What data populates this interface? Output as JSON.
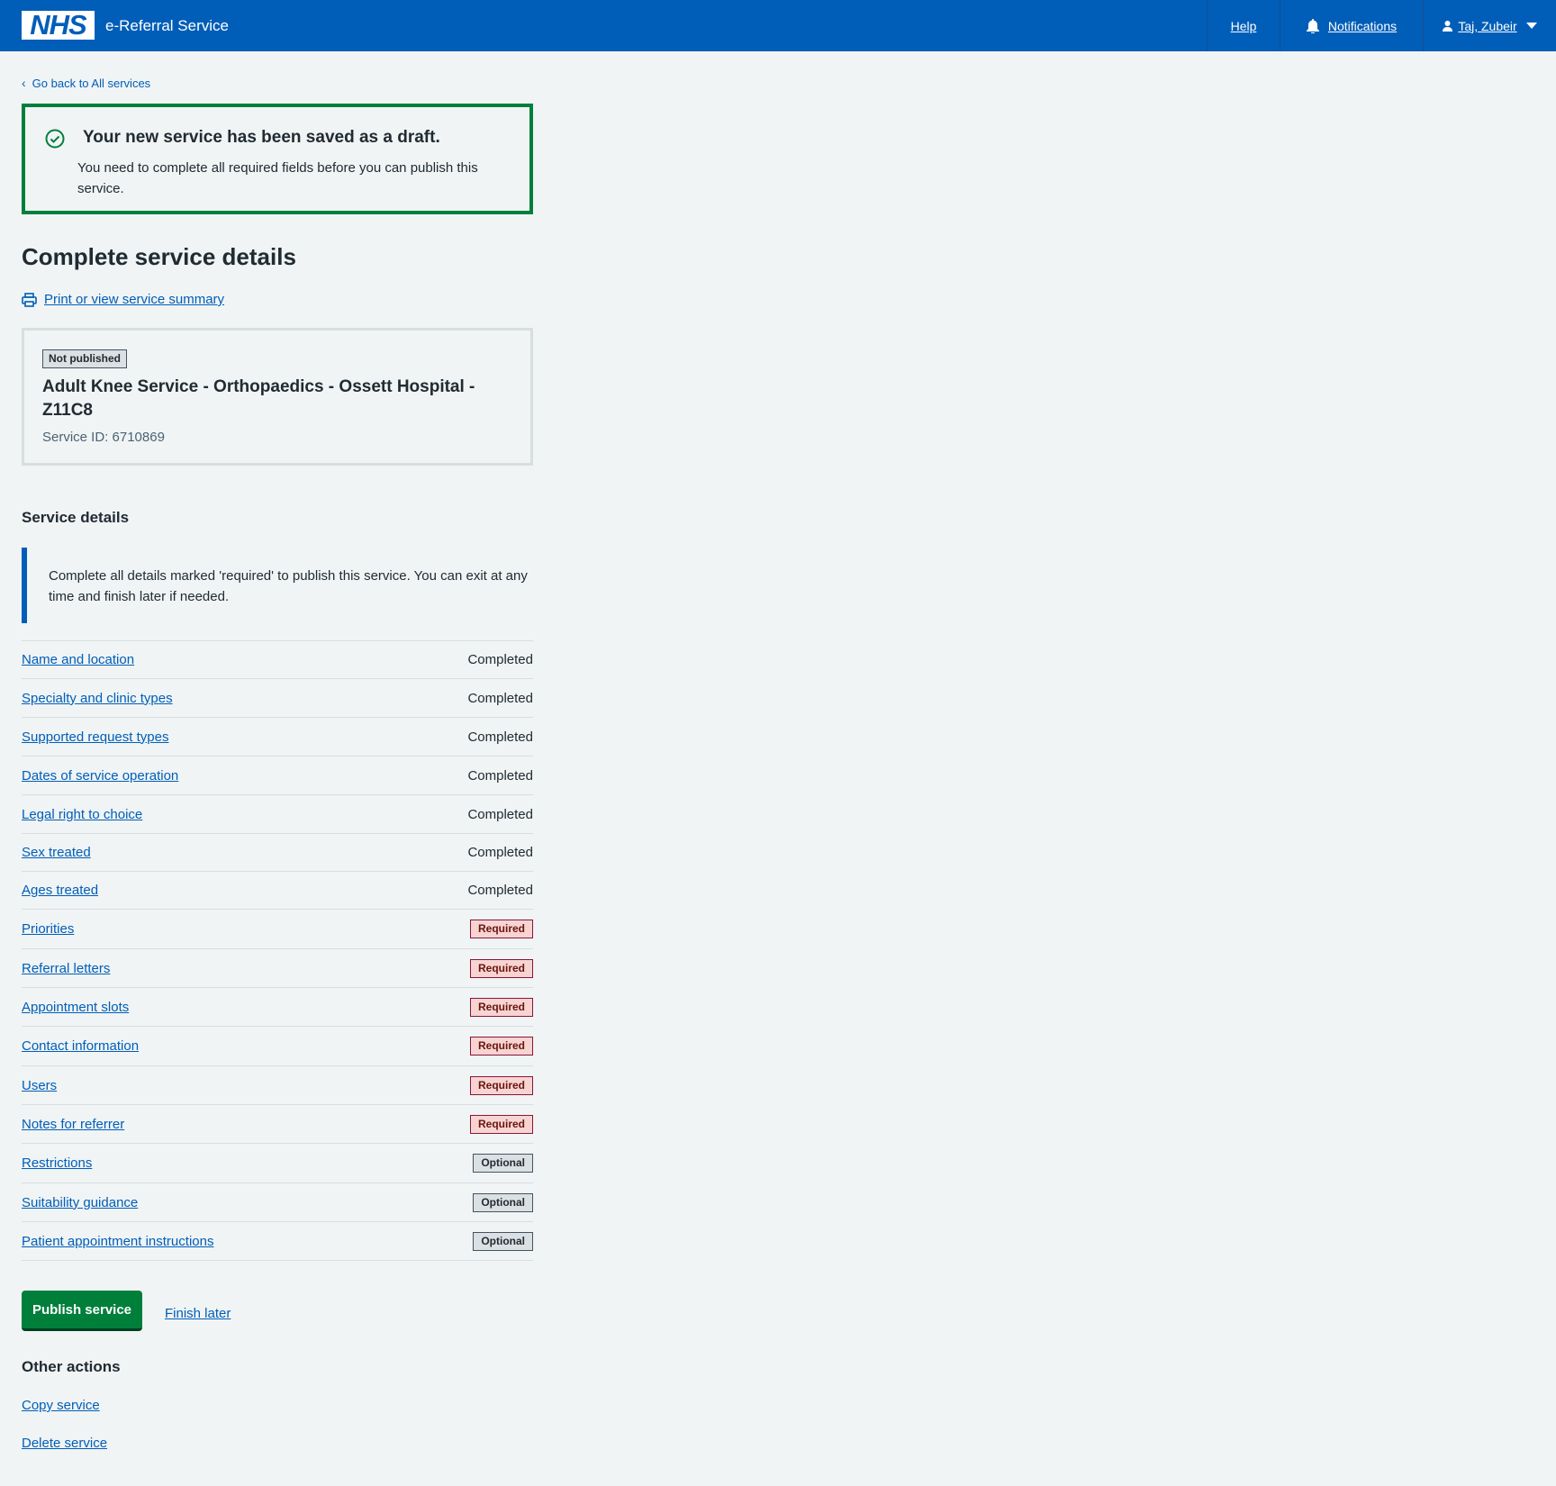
{
  "header": {
    "logo": "NHS",
    "service_name": "e-Referral Service",
    "nav": {
      "help": "Help",
      "notifications": "Notifications",
      "user": "Taj, Zubeir"
    }
  },
  "back_link": "Go back to All services",
  "banner": {
    "title": "Your new service has been saved as a draft.",
    "body": "You need to complete all required fields before you can publish this service."
  },
  "page_title": "Complete service details",
  "print_link": "Print or view service summary",
  "summary": {
    "status": "Not published",
    "name": "Adult Knee Service - Orthopaedics - Ossett Hospital - Z11C8",
    "service_id": "Service ID: 6710869"
  },
  "section_title": "Service details",
  "inset_text": "Complete all details marked 'required' to publish this service. You can exit at any time and finish later if needed.",
  "tasks": [
    {
      "label": "Name and location",
      "status": "Completed"
    },
    {
      "label": "Specialty and clinic types",
      "status": "Completed"
    },
    {
      "label": "Supported request types",
      "status": "Completed"
    },
    {
      "label": "Dates of service operation",
      "status": "Completed"
    },
    {
      "label": "Legal right to choice",
      "status": "Completed"
    },
    {
      "label": "Sex treated",
      "status": "Completed"
    },
    {
      "label": "Ages treated",
      "status": "Completed"
    },
    {
      "label": "Priorities",
      "status": "Required"
    },
    {
      "label": "Referral letters",
      "status": "Required"
    },
    {
      "label": "Appointment slots",
      "status": "Required"
    },
    {
      "label": "Contact information",
      "status": "Required"
    },
    {
      "label": "Users",
      "status": "Required"
    },
    {
      "label": "Notes for referrer",
      "status": "Required"
    },
    {
      "label": "Restrictions",
      "status": "Optional"
    },
    {
      "label": "Suitability guidance",
      "status": "Optional"
    },
    {
      "label": "Patient appointment instructions",
      "status": "Optional"
    }
  ],
  "actions": {
    "publish": "Publish service",
    "finish_later": "Finish later"
  },
  "other_actions": {
    "title": "Other actions",
    "copy": "Copy service",
    "delete": "Delete service"
  },
  "colors": {
    "nhs_blue": "#005eb8",
    "success_green": "#007f3b",
    "background": "#f0f4f5"
  }
}
